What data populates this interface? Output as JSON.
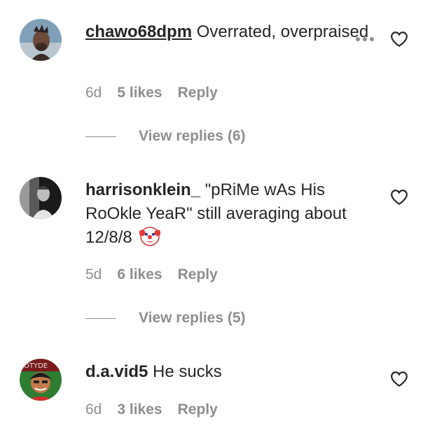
{
  "comments": [
    {
      "username": "chawo68dpm",
      "text": "Overrated, overpraised",
      "time": "6d",
      "likes": "5 likes",
      "reply": "Reply",
      "view_replies": "View replies (6)",
      "avatar_icon": "user-avatar-photo"
    },
    {
      "username": "harrisonklein_",
      "text": "\"pRiMe wAs His RoOkle YeaR\" still averaging about 12/8/8",
      "emoji": "clown-face-emoji",
      "time": "5d",
      "likes": "6 likes",
      "reply": "Reply",
      "view_replies": "View replies (5)",
      "avatar_icon": "user-avatar-photo"
    },
    {
      "username": "d.a.vid5",
      "text": "He sucks",
      "time": "6d",
      "likes": "3 likes",
      "reply": "Reply",
      "avatar_icon": "user-avatar-cartoon"
    }
  ],
  "icons": {
    "like": "heart-outline-icon",
    "more": "more-options-icon"
  }
}
